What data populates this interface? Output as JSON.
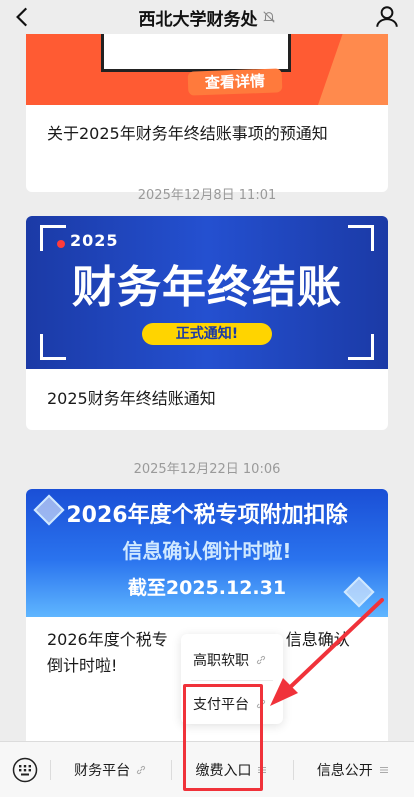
{
  "header": {
    "title": "西北大学财务处"
  },
  "feed": {
    "article1": {
      "banner_button": "查看详情",
      "title": "关于2025年财务年终结账事项的预通知"
    },
    "timestamp2": "2025年12月8日 11:01",
    "article2": {
      "banner_year": "2025",
      "banner_main": "财务年终结账",
      "banner_pill": "正式通知!",
      "title": "2025财务年终结账通知"
    },
    "timestamp3": "2025年12月22日 10:06",
    "article3": {
      "banner_line1": "2026年度个税专项附加扣除",
      "banner_line2": "信息确认倒计时啦!",
      "banner_line3": "截至2025.12.31",
      "title_part1": "2026年度个税专",
      "title_part2": "信息确认",
      "title_part3": "倒计时啦!"
    }
  },
  "popup": {
    "items": [
      {
        "label": "高职软职",
        "icon": "link-icon"
      },
      {
        "label": "支付平台",
        "icon": "link-icon"
      }
    ]
  },
  "bottom_menu": {
    "items": [
      {
        "label": "财务平台",
        "icon": "link-icon"
      },
      {
        "label": "缴费入口",
        "icon": "menu-icon"
      },
      {
        "label": "信息公开",
        "icon": "menu-icon"
      }
    ]
  },
  "colors": {
    "annotation": "#f0323a",
    "banner1": "#ff5b33",
    "banner2": "#1b3aa6",
    "banner3": "#2a73ee"
  }
}
